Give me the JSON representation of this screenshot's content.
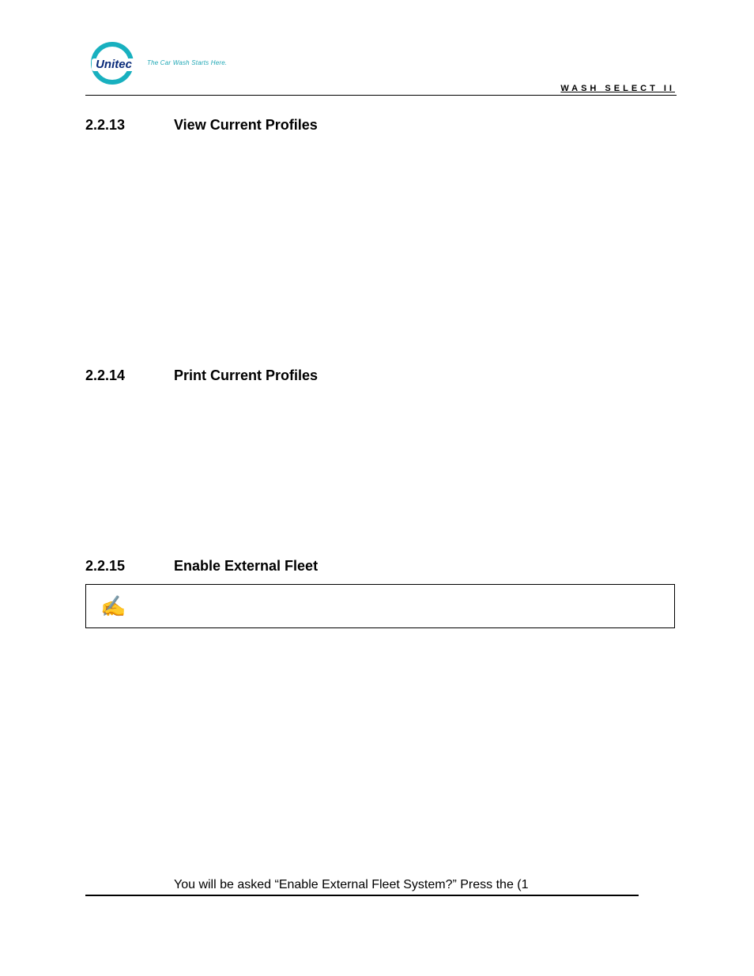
{
  "header": {
    "brand": "Unitec",
    "tagline": "The Car Wash Starts Here.",
    "right_label": "WASH SELECT II"
  },
  "sections": [
    {
      "number": "2.2.13",
      "title": "View Current Profiles"
    },
    {
      "number": "2.2.14",
      "title": "Print Current Profiles"
    },
    {
      "number": "2.2.15",
      "title": "Enable External Fleet"
    }
  ],
  "note": {
    "icon_name": "note-handwriting-icon"
  },
  "body": {
    "line": "You will be asked “Enable External Fleet System?” Press the (1"
  }
}
